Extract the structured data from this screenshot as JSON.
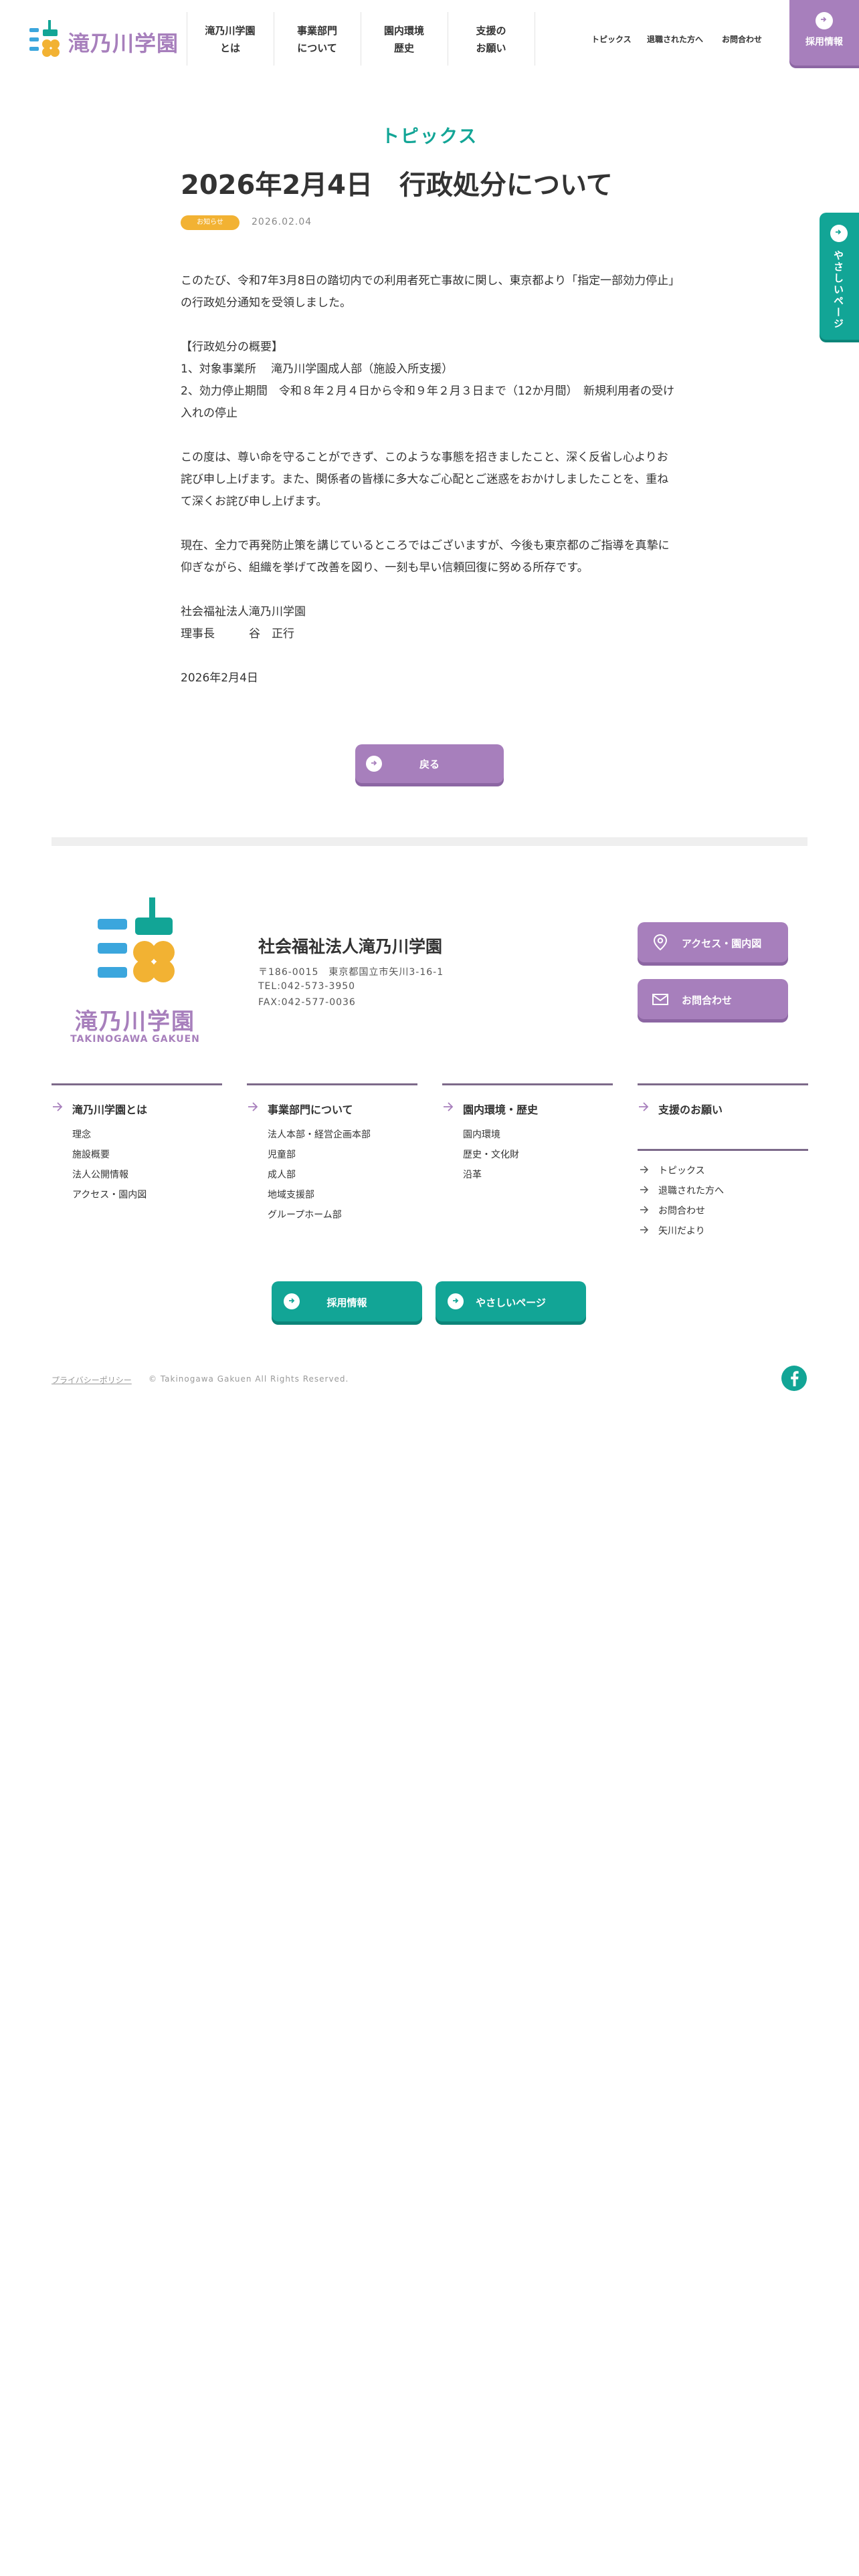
{
  "header": {
    "logo_text": "滝乃川学園",
    "nav": [
      {
        "label": "滝乃川学園\nとは"
      },
      {
        "label": "事業部門\nについて"
      },
      {
        "label": "園内環境\n歴史"
      },
      {
        "label": "支援の\nお願い"
      }
    ],
    "util_links": [
      "トピックス",
      "退職された方へ",
      "お問合わせ"
    ],
    "recruit_label": "採用情報"
  },
  "side_tab": {
    "label": "やさしいページ"
  },
  "article": {
    "section_label": "トピックス",
    "title": "2026年2月4日　行政処分について",
    "category": "お知らせ",
    "date": "2026.02.04",
    "paragraphs": [
      "このたび、令和7年3月8日の踏切内での利用者死亡事故に関し、東京都より「指定一部効力停止」の行政処分通知を受領しました。",
      "【行政処分の概要】\n1、対象事業所　 滝乃川学園成人部（施設入所支援）\n2、効力停止期間　令和８年２月４日から令和９年２月３日まで（12か月間）　新規利用者の受け入れの停止",
      "この度は、尊い命を守ることができず、このような事態を招きましたこと、深く反省し心よりお詫び申し上げます。また、関係者の皆様に多大なご心配とご迷惑をおかけしましたことを、重ねて深くお詫び申し上げます。",
      "現在、全力で再発防止策を講じているところではございますが、今後も東京都のご指導を真摯に仰ぎながら、組織を挙げて改善を図り、一刻も早い信頼回復に努める所存です。",
      "社会福祉法人滝乃川学園\n理事長　　　谷　正行",
      "2026年2月4日"
    ],
    "back_label": "戻る"
  },
  "footer": {
    "logo_caption": "滝乃川学園",
    "logo_sub": "TAKINOGAWA GAKUEN",
    "org_name": "社会福祉法人滝乃川学園",
    "address": "〒186-0015　東京都国立市矢川3-16-1",
    "tel": "TEL:042-573-3950",
    "fax": "FAX:042-577-0036",
    "access_label": "アクセス・園内図",
    "contact_label": "お問合わせ",
    "columns": [
      {
        "heading": "滝乃川学園とは",
        "links": [
          "理念",
          "施設概要",
          "法人公開情報",
          "アクセス・園内図"
        ]
      },
      {
        "heading": "事業部門について",
        "links": [
          "法人本部・経営企画本部",
          "児童部",
          "成人部",
          "地域支援部",
          "グループホーム部"
        ]
      },
      {
        "heading": "園内環境・歴史",
        "links": [
          "園内環境",
          "歴史・文化財",
          "沿革"
        ]
      },
      {
        "heading": "支援のお願い",
        "links": [
          "トピックス",
          "退職された方へ",
          "お問合わせ",
          "矢川だより"
        ]
      }
    ],
    "recruit_btn": "採用情報",
    "yasashii_btn": "やさしいページ",
    "privacy": "プライバシーポリシー",
    "copyright": "© Takinogawa Gakuen All Rights Reserved."
  },
  "colors": {
    "purple": "#a77fbc",
    "teal": "#12a596",
    "blue": "#3ba6dd",
    "yellow": "#f2b233"
  },
  "icons": [
    "arrow-right-icon",
    "location-pin-icon",
    "mail-icon",
    "facebook-icon"
  ]
}
